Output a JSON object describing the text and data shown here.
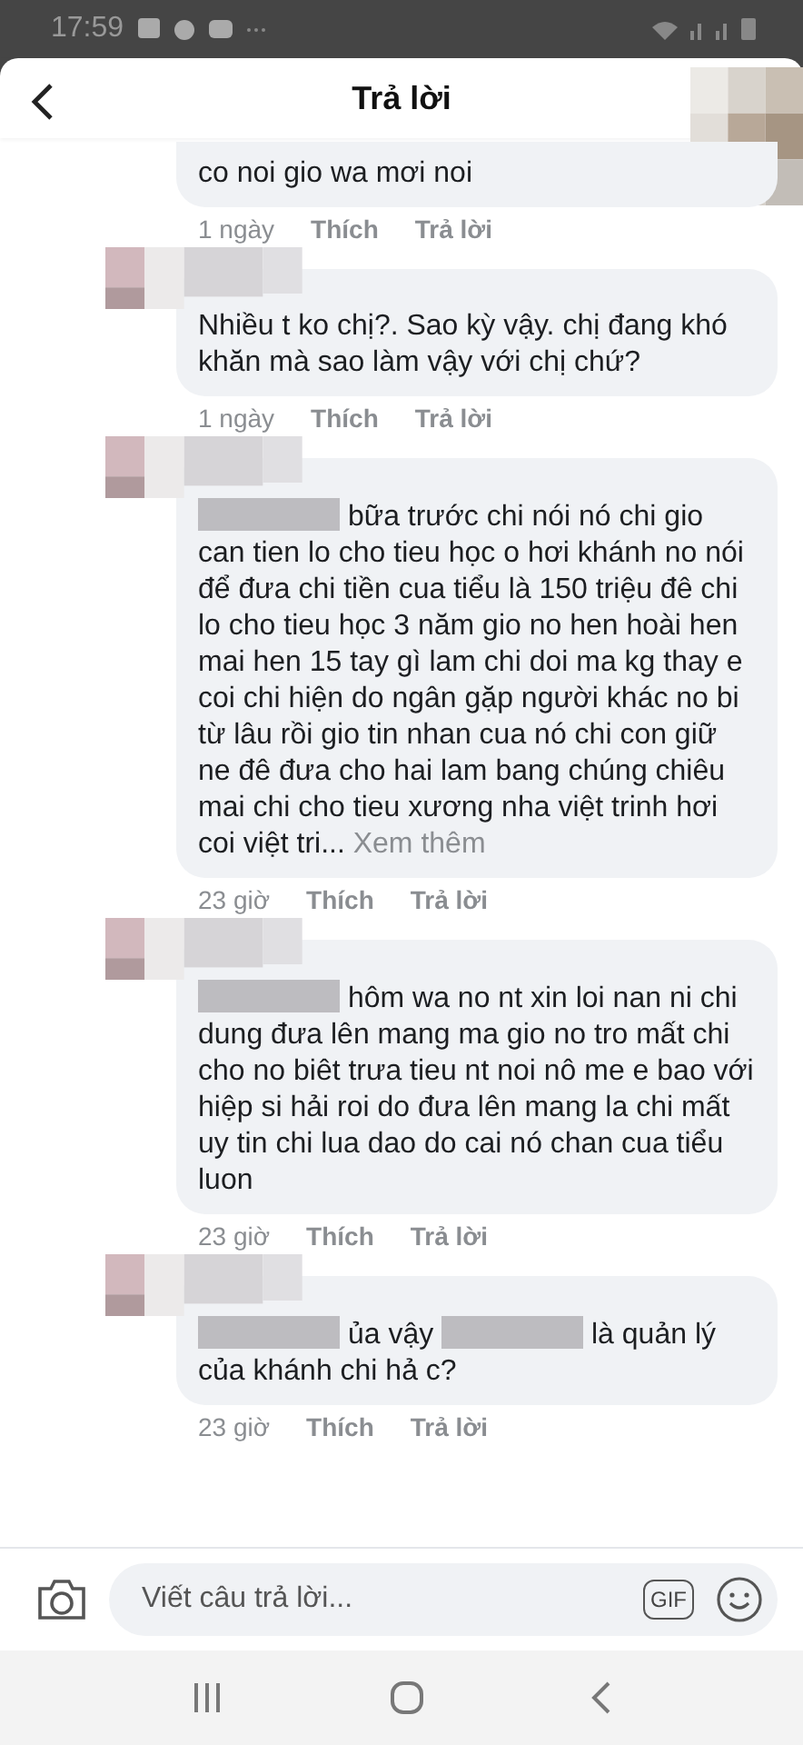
{
  "status_bar": {
    "time": "17:59"
  },
  "header": {
    "title": "Trả lời"
  },
  "comments": [
    {
      "name_hidden": false,
      "segments": [
        {
          "kind": "text",
          "text": "co noi gio wa mơi noi"
        }
      ],
      "time": "1 ngày",
      "like": "Thích",
      "reply": "Trả lời"
    },
    {
      "name_hidden": true,
      "segments": [
        {
          "kind": "text",
          "text": "Nhiều t ko chị?. Sao kỳ vậy. chị đang khó khăn mà sao  làm vậy với chị chứ?"
        }
      ],
      "time": "1 ngày",
      "like": "Thích",
      "reply": "Trả lời"
    },
    {
      "name_hidden": true,
      "segments": [
        {
          "kind": "redacted"
        },
        {
          "kind": "text",
          "text": "bữa trước  chi nói  nó  chi gio can tien lo cho tieu học o hơi khánh  no nói để đưa  chi tiền cua tiểu là 150 triệu đê chi lo cho tieu học 3 năm gio no hen hoài  hen mai hen 15 tay gì lam chi doi ma kg thay e coi chi hiện do ngân  gặp người khác no bi từ lâu rồi gio tin nhan cua nó  chi con giữ ne đê đưa cho hai lam bang chúng chiêu mai chi cho tieu xương nha việt trinh hơi coi việt tri..."
        },
        {
          "kind": "more",
          "text": "Xem thêm"
        }
      ],
      "time": "23 giờ",
      "like": "Thích",
      "reply": "Trả lời"
    },
    {
      "name_hidden": true,
      "segments": [
        {
          "kind": "redacted"
        },
        {
          "kind": "text",
          "text": "hôm wa no nt xin loi nan ni chi dung đưa lên mang ma gio no tro mất chi cho no biêt trưa tieu nt noi nô me e bao với  hiệp si hải  roi do đưa lên mang la chi mất uy tin chi lua dao do cai nó  chan cua tiểu luon"
        }
      ],
      "time": "23 giờ",
      "like": "Thích",
      "reply": "Trả lời"
    },
    {
      "name_hidden": true,
      "segments": [
        {
          "kind": "redacted"
        },
        {
          "kind": "text",
          "text": "ủa vậy"
        },
        {
          "kind": "redacted"
        },
        {
          "kind": "text",
          "text": "là quản lý của khánh chi hả c?"
        }
      ],
      "time": "23 giờ",
      "like": "Thích",
      "reply": "Trả lời"
    }
  ],
  "composer": {
    "placeholder": "Viết câu trả lời...",
    "gif_label": "GIF"
  }
}
